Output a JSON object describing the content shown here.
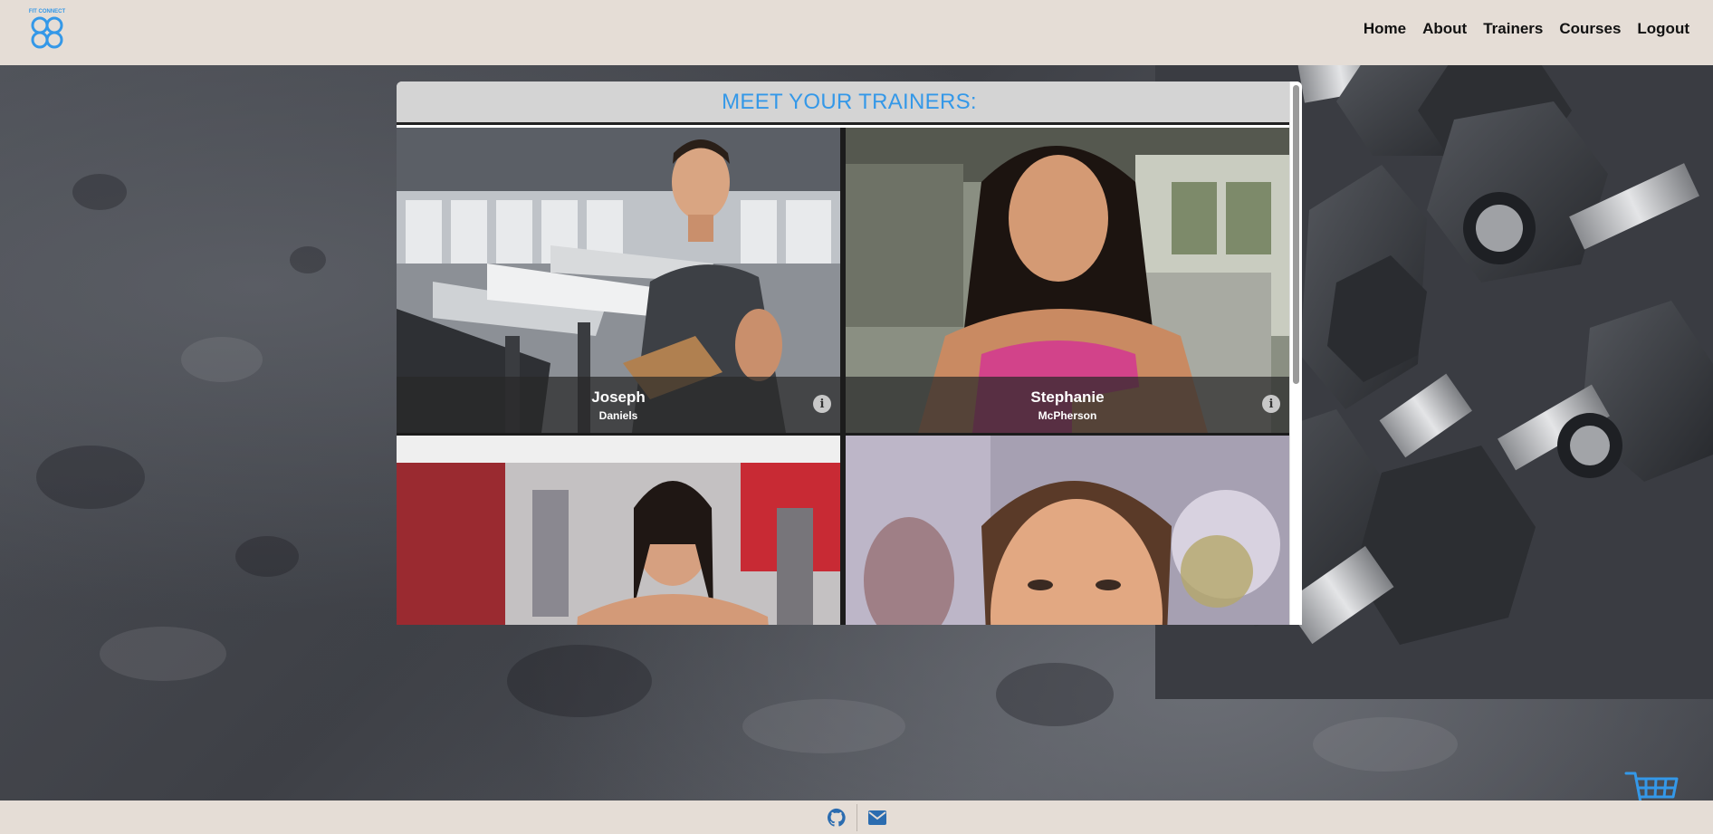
{
  "app": {
    "logo_name": "FIT CONNECT"
  },
  "nav": {
    "items": [
      {
        "label": "Home"
      },
      {
        "label": "About"
      },
      {
        "label": "Trainers"
      },
      {
        "label": "Courses"
      },
      {
        "label": "Logout"
      }
    ]
  },
  "main": {
    "title": "MEET YOUR TRAINERS:",
    "trainers": [
      {
        "first": "Joseph",
        "last": "Daniels",
        "info_icon": "info-icon"
      },
      {
        "first": "Stephanie",
        "last": "McPherson",
        "info_icon": "info-icon"
      },
      {
        "first": "",
        "last": ""
      },
      {
        "first": "",
        "last": ""
      }
    ]
  },
  "footer": {
    "icons": [
      "github-icon",
      "mail-icon"
    ]
  },
  "cart": {
    "icon": "shopping-cart-icon"
  },
  "colors": {
    "accent": "#3498e8",
    "header_bg": "#e5ddd6",
    "title_bar_bg": "#d4d4d4"
  }
}
